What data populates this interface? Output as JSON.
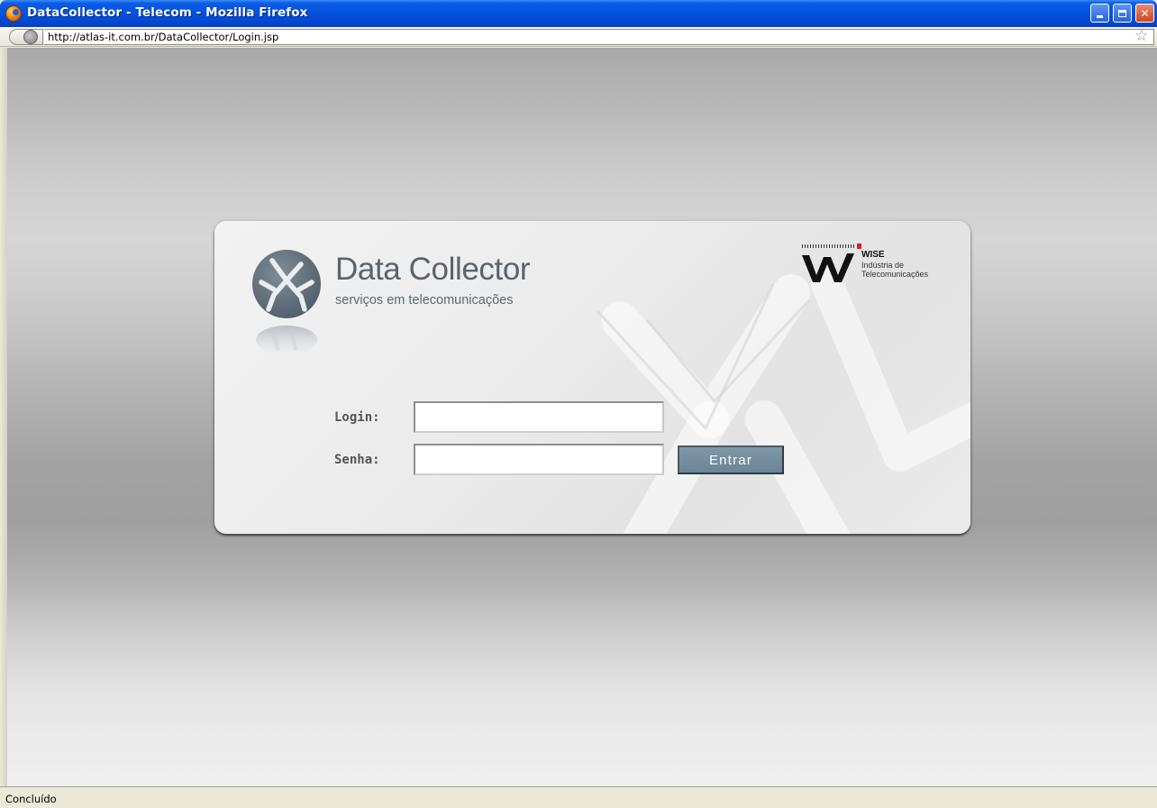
{
  "window": {
    "title": "DataCollector - Telecom - Mozilla Firefox",
    "controls": [
      "minimize",
      "restore",
      "close"
    ]
  },
  "addressbar": {
    "url": "http://atlas-it.com.br/DataCollector/Login.jsp"
  },
  "brand": {
    "title": "Data Collector",
    "subtitle": "serviços em telecomunicações",
    "icon": "data-collector-logo-icon"
  },
  "partner": {
    "name": "WISE",
    "line1": "Indústria de",
    "line2": "Telecomunicações",
    "icon": "wise-logo-icon"
  },
  "form": {
    "login_label": "Login:",
    "login_value": "",
    "password_label": "Senha:",
    "password_value": "",
    "submit_label": "Entrar"
  },
  "status": {
    "text": "Concluído"
  },
  "colors": {
    "titlebar": "#0553dc",
    "button": "#7890a0",
    "brand_text": "#59646e"
  }
}
